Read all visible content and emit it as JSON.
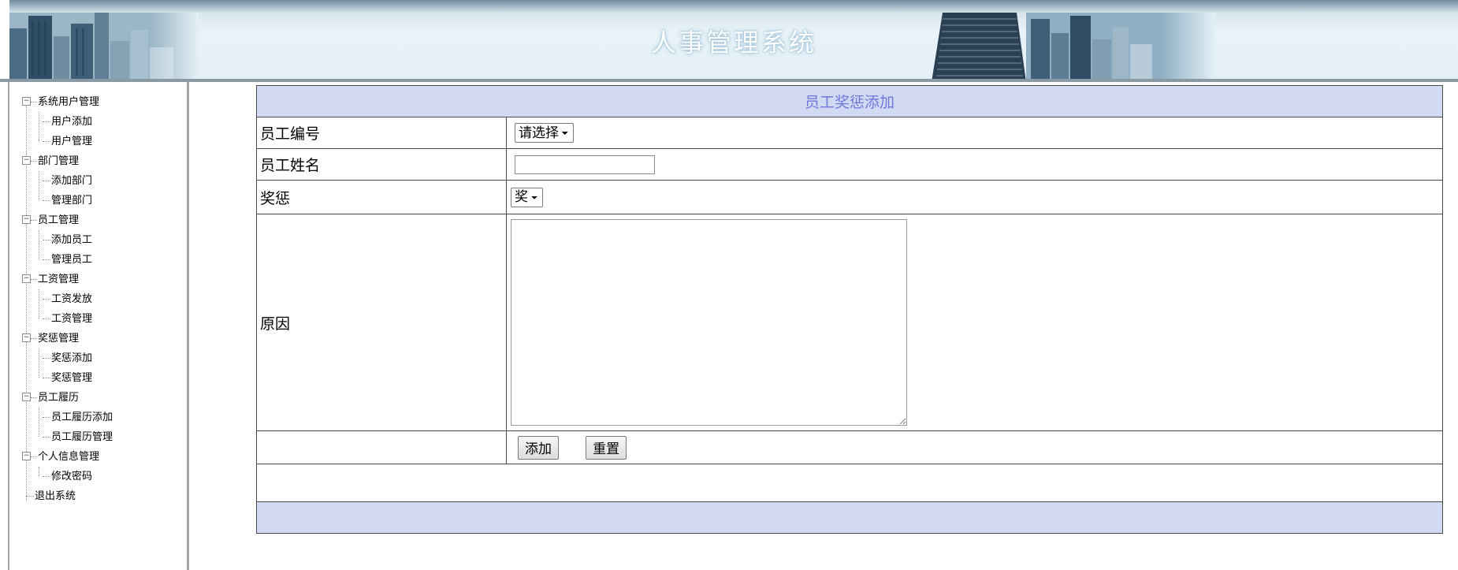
{
  "app": {
    "title": "人事管理系统"
  },
  "sidebar": {
    "groups": [
      {
        "label": "系统用户管理",
        "items": [
          {
            "label": "用户添加"
          },
          {
            "label": "用户管理"
          }
        ]
      },
      {
        "label": "部门管理",
        "items": [
          {
            "label": "添加部门"
          },
          {
            "label": "管理部门"
          }
        ]
      },
      {
        "label": "员工管理",
        "items": [
          {
            "label": "添加员工"
          },
          {
            "label": "管理员工"
          }
        ]
      },
      {
        "label": "工资管理",
        "items": [
          {
            "label": "工资发放"
          },
          {
            "label": "工资管理"
          }
        ]
      },
      {
        "label": "奖惩管理",
        "items": [
          {
            "label": "奖惩添加"
          },
          {
            "label": "奖惩管理"
          }
        ]
      },
      {
        "label": "员工履历",
        "items": [
          {
            "label": "员工履历添加"
          },
          {
            "label": "员工履历管理"
          }
        ]
      },
      {
        "label": "个人信息管理",
        "items": [
          {
            "label": "修改密码"
          }
        ]
      }
    ],
    "logout": {
      "label": "退出系统"
    }
  },
  "form": {
    "title": "员工奖惩添加",
    "employee_id": {
      "label": "员工编号",
      "selected": "请选择"
    },
    "employee_name": {
      "label": "员工姓名",
      "value": ""
    },
    "reward_punish": {
      "label": "奖惩",
      "selected": "奖"
    },
    "reason": {
      "label": "原因",
      "value": ""
    },
    "buttons": {
      "add": "添加",
      "reset": "重置"
    }
  },
  "colors": {
    "header_row_bg": "#d1daf2",
    "header_row_text": "#6f78dc",
    "table_border": "#4a4a4a"
  },
  "icons": {
    "tree_expander": "minus-box-icon",
    "textarea_resize": "resize-grip-icon"
  }
}
